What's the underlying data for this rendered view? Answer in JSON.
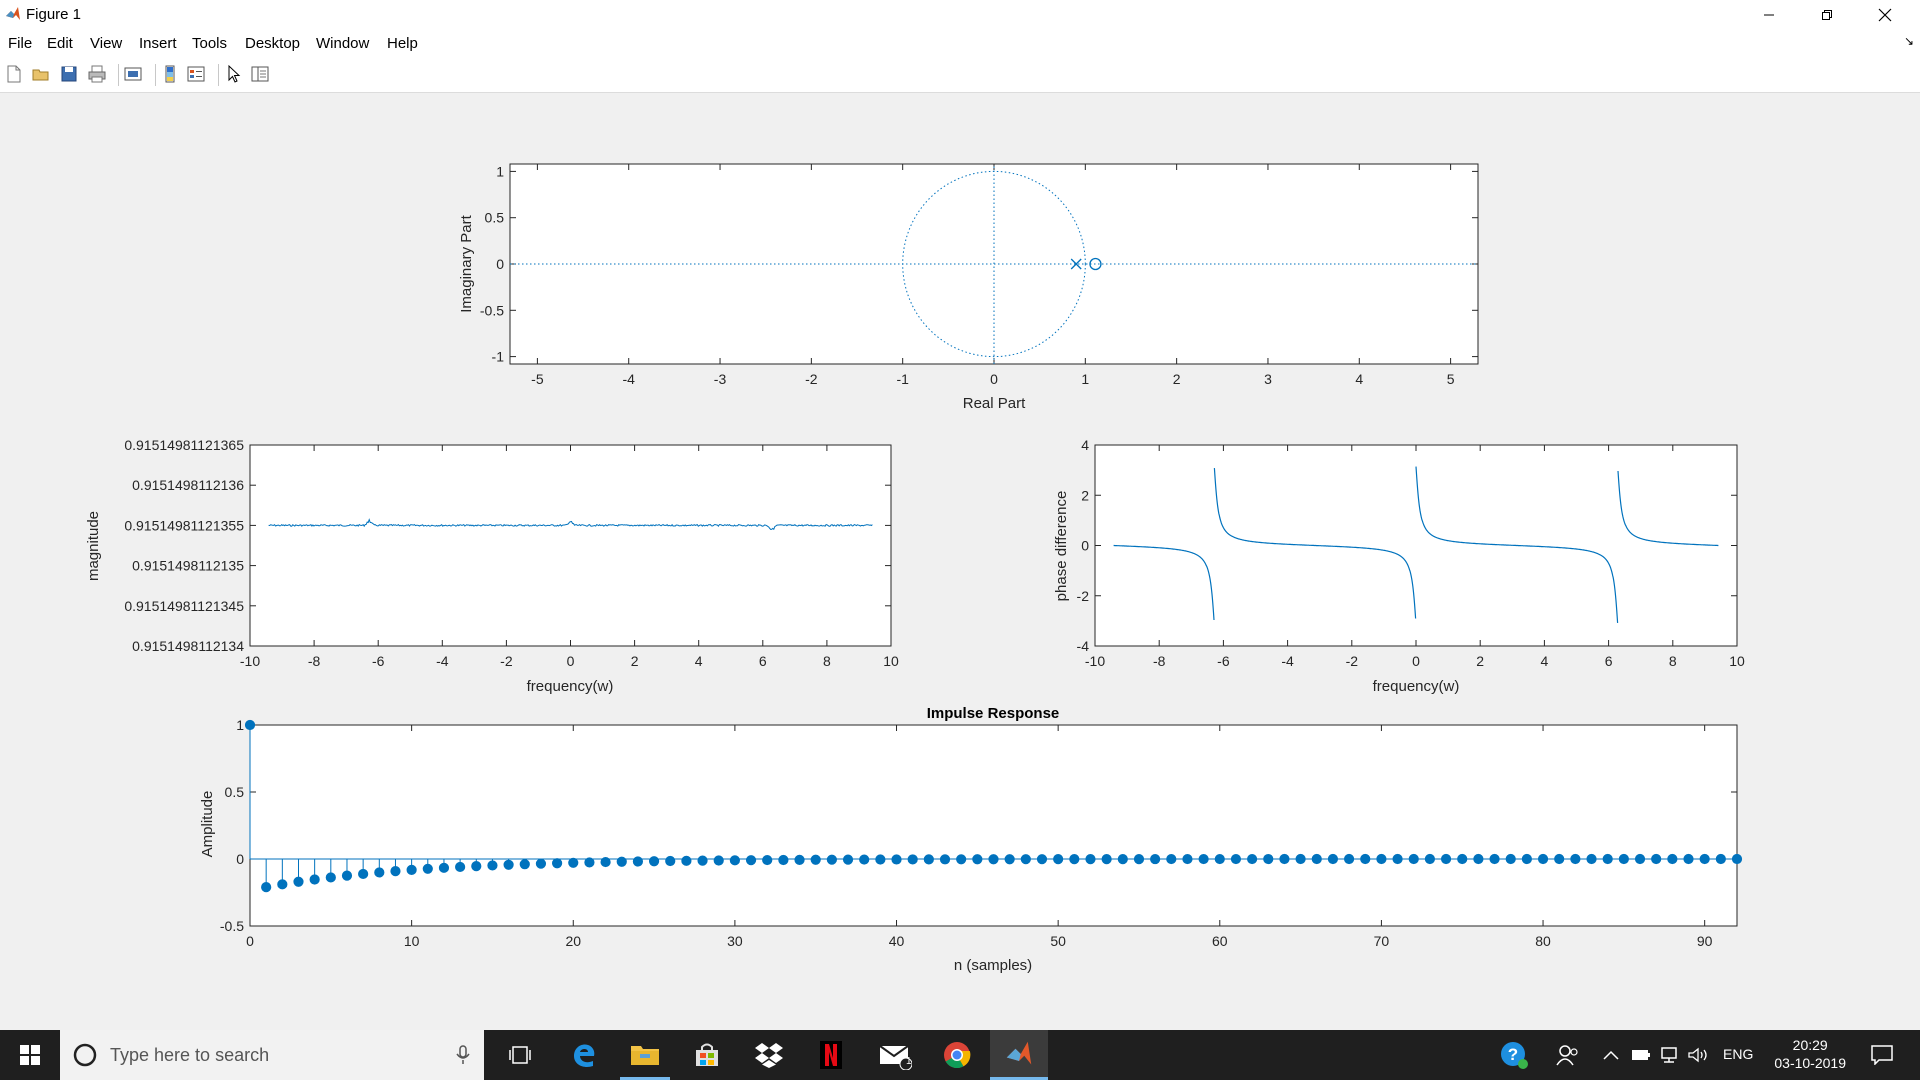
{
  "window": {
    "title": "Figure 1",
    "controls": {
      "minimize": "minimize-icon",
      "restore": "restore-icon",
      "close": "close-icon"
    }
  },
  "menu": {
    "items": [
      {
        "label": "File",
        "key": "F"
      },
      {
        "label": "Edit",
        "key": "E"
      },
      {
        "label": "View",
        "key": "V"
      },
      {
        "label": "Insert",
        "key": "I"
      },
      {
        "label": "Tools",
        "key": "T"
      },
      {
        "label": "Desktop",
        "key": "D"
      },
      {
        "label": "Window",
        "key": "W"
      },
      {
        "label": "Help",
        "key": "H"
      }
    ]
  },
  "toolbar": {
    "icons": [
      "new-figure-icon",
      "open-file-icon",
      "save-icon",
      "print-icon",
      "link-plot-icon",
      "insert-colorbar-icon",
      "insert-legend-icon",
      "edit-plot-icon",
      "property-inspector-icon"
    ]
  },
  "colors": {
    "plot": "#0072bd",
    "axes_bg": "#ffffff",
    "taskbar": "#1f1f1f"
  },
  "chart_data": [
    {
      "type": "scatter",
      "name": "pole-zero",
      "xlabel": "Real Part",
      "ylabel": "Imaginary Part",
      "xlim": [
        -5.3,
        5.3
      ],
      "ylim": [
        -1.08,
        1.08
      ],
      "xticks": [
        -5,
        -4,
        -3,
        -2,
        -1,
        0,
        1,
        2,
        3,
        4,
        5
      ],
      "yticks": [
        -1,
        -0.5,
        0,
        0.5,
        1
      ],
      "ytick_labels": [
        "-1",
        "-0.5",
        "0",
        "0.5",
        "1"
      ],
      "unit_circle": true,
      "poles": [
        [
          0.9,
          0
        ]
      ],
      "zeros": [
        [
          1.111,
          0
        ]
      ]
    },
    {
      "type": "line",
      "name": "magnitude",
      "xlabel": "frequency(w)",
      "ylabel": "magnitude",
      "xlim": [
        -10,
        10
      ],
      "xticks": [
        -10,
        -8,
        -6,
        -4,
        -2,
        0,
        2,
        4,
        6,
        8,
        10
      ],
      "ytick_labels": [
        "0.91514981121365",
        "0.9151498112136",
        "0.91514981121355",
        "0.9151498112135",
        "0.91514981121345",
        "0.9151498112134"
      ],
      "x_range": [
        -9.42,
        9.42
      ],
      "level_fraction": 0.6,
      "blips": [
        -6.28,
        0,
        6.28
      ]
    },
    {
      "type": "line",
      "name": "phase",
      "xlabel": "frequency(w)",
      "ylabel": "phase difference",
      "xlim": [
        -10,
        10
      ],
      "ylim": [
        -4,
        4
      ],
      "xticks": [
        -10,
        -8,
        -6,
        -4,
        -2,
        0,
        2,
        4,
        6,
        8,
        10
      ],
      "yticks": [
        -4,
        -2,
        0,
        2,
        4
      ],
      "x_range": [
        -9.42,
        9.42
      ],
      "a": 0.9
    },
    {
      "type": "stem",
      "name": "impulse",
      "title": "Impulse Response",
      "xlabel": "n (samples)",
      "ylabel": "Amplitude",
      "xlim": [
        0,
        92
      ],
      "ylim": [
        -0.5,
        1
      ],
      "xticks": [
        0,
        10,
        20,
        30,
        40,
        50,
        60,
        70,
        80,
        90
      ],
      "yticks": [
        -0.5,
        0,
        0.5,
        1
      ],
      "ytick_labels": [
        "-0.5",
        "0",
        "0.5",
        "1"
      ],
      "n_points": 92,
      "first_value": 1,
      "tail_start": -0.2099,
      "ratio": 0.9
    }
  ],
  "taskbar": {
    "search_placeholder": "Type here to search",
    "language": "ENG",
    "time": "20:29",
    "date": "03-10-2019",
    "mail_badge": "1"
  }
}
